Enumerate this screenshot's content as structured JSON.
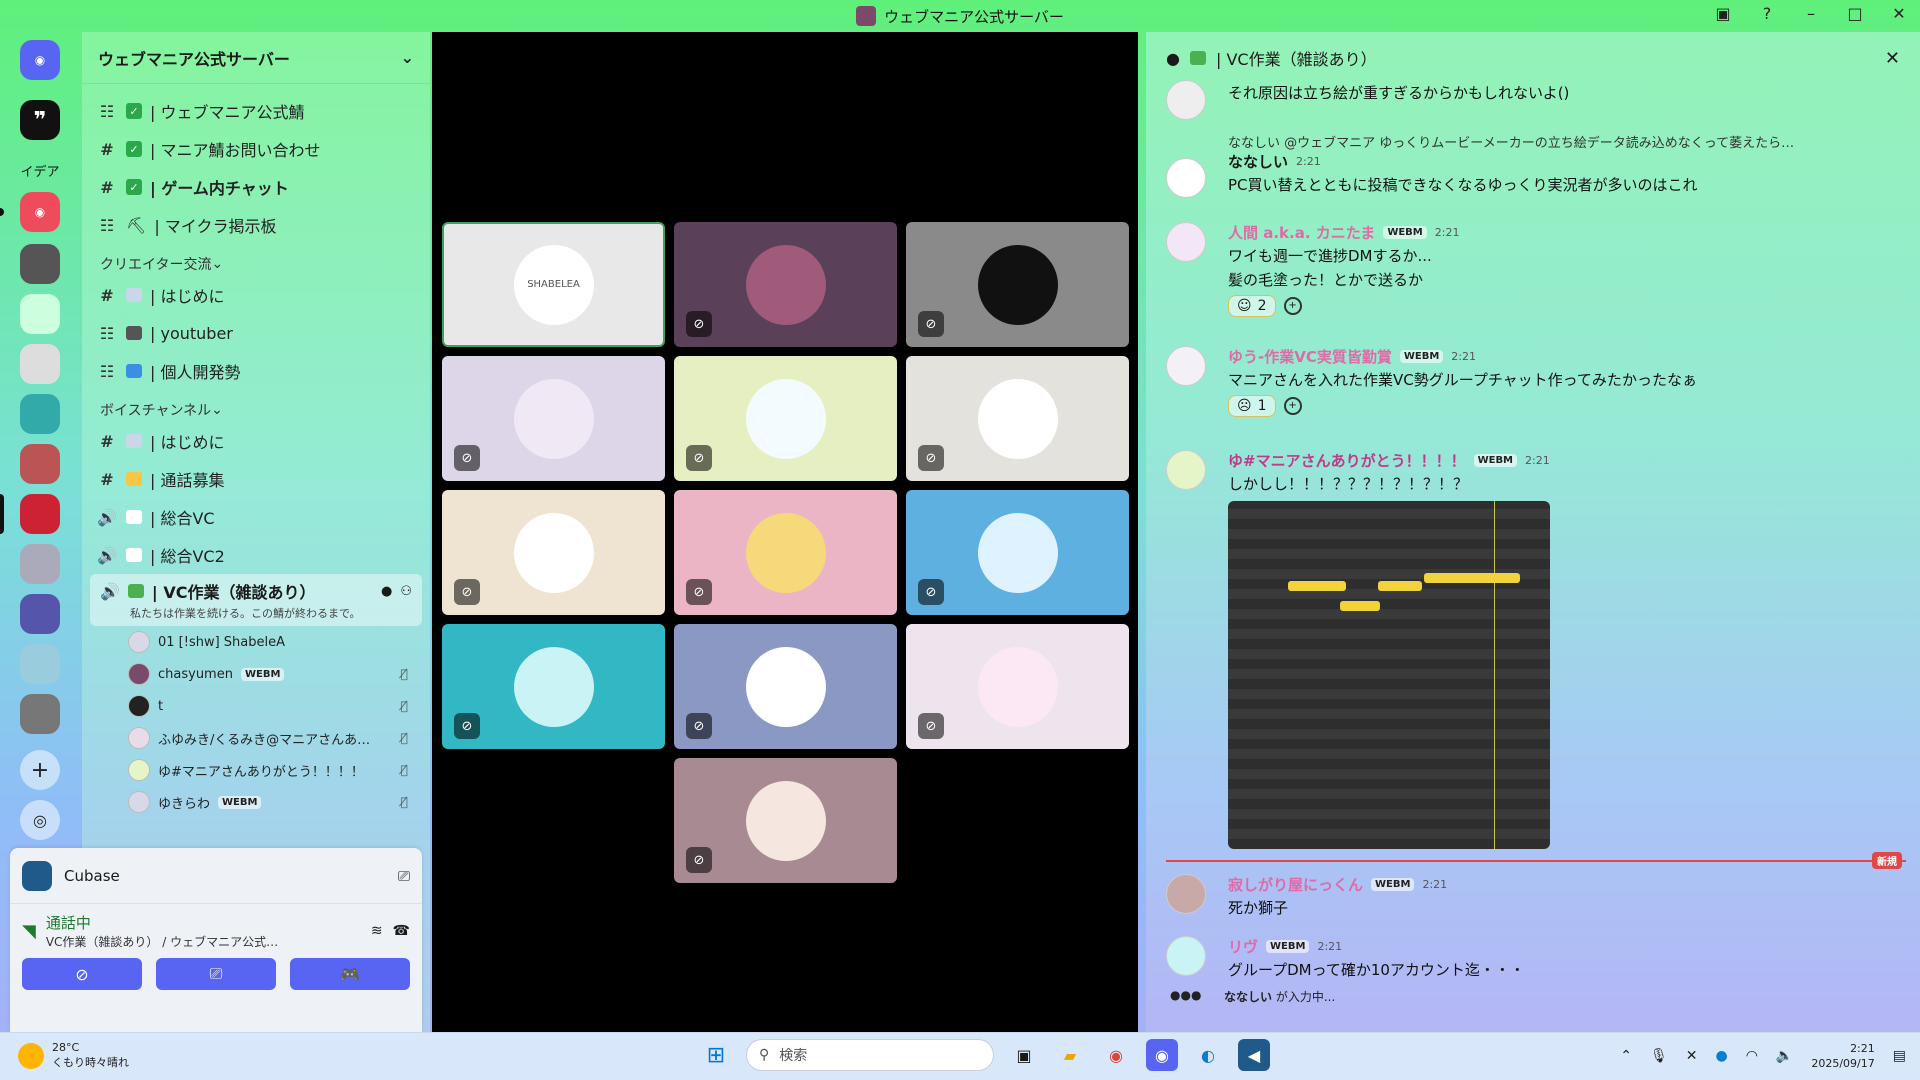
{
  "window": {
    "title": "ウェブマニア公式サーバー"
  },
  "server": {
    "name": "ウェブマニア公式サーバー"
  },
  "channels_top": [
    {
      "icon": "forum",
      "label": "| ウェブマニア公式鯖"
    },
    {
      "icon": "#",
      "label": "| マニア鯖お問い合わせ"
    },
    {
      "icon": "#",
      "label": "| ゲーム内チャット"
    },
    {
      "icon": "forum",
      "label": "| マイクラ掲示板"
    }
  ],
  "categories": {
    "creator": "クリエイター交流",
    "voice": "ボイスチャンネル"
  },
  "creator_channels": [
    {
      "icon": "#",
      "label": "| はじめに"
    },
    {
      "icon": "forum",
      "label": "| youtuber"
    },
    {
      "icon": "forum",
      "label": "| 個人開発勢"
    }
  ],
  "voice_channels": [
    {
      "icon": "#",
      "label": "| はじめに"
    },
    {
      "icon": "#",
      "label": "| 通話募集"
    },
    {
      "icon": "vc",
      "label": "| 総合VC"
    },
    {
      "icon": "vc",
      "label": "| 総合VC2"
    }
  ],
  "active_vc": {
    "name": "| VC作業（雑談あり）",
    "topic": "私たちは作業を続ける。この鯖が終わるまで。"
  },
  "voice_users": [
    {
      "name": "01 [!shw] ShabeleA",
      "tag": ""
    },
    {
      "name": "chasyumen",
      "tag": "WEBM"
    },
    {
      "name": "t",
      "tag": ""
    },
    {
      "name": "ふゆみき/くるみき@マニアさんあ…",
      "tag": ""
    },
    {
      "name": "ゆ#マニアさんありがとう！！！！",
      "tag": ""
    },
    {
      "name": "ゆきらわ",
      "tag": "WEBM"
    }
  ],
  "panel": {
    "app_name": "Cubase",
    "status": "通話中",
    "channel_path": "VC作業（雑談あり） / ウェブマニア公式…"
  },
  "stage": {
    "tile_0_label": "SHABELEA"
  },
  "thread": {
    "title": "| VC作業（雑談あり）",
    "new_label": "新規",
    "typing_user": "ななしい",
    "typing_suffix": "が入力中..."
  },
  "messages": [
    {
      "name": "",
      "time": "",
      "text": "それ原因は立ち絵が重すぎるからかもしれないよ()"
    },
    {
      "reply": "ななしい @ウェブマニア ゆっくりムービーメーカーの立ち絵データ読み込めなくって萎えたら…",
      "name": "ななしい",
      "time": "2:21",
      "text": "PC買い替えとともに投稿できなくなるゆっくり実況者が多いのはこれ"
    },
    {
      "name": "人間 a.k.a. カニたま",
      "tag": "WEBM",
      "time": "2:21",
      "text": "ワイも週一で進捗DMするか...",
      "text2": "髪の毛塗った！とかで送るか",
      "reaction": "2"
    },
    {
      "name": "ゆう-作業VC実質皆勤賞",
      "tag": "WEBM",
      "time": "2:21",
      "text": "マニアさんを入れた作業VC勢グループチャット作ってみたかったなぁ",
      "reaction": "1"
    },
    {
      "name": "ゆ#マニアさんありがとう！！！！",
      "tag": "WEBM",
      "time": "2:21",
      "text": "しかしし！！！？？？！？！？！？"
    },
    {
      "name": "寂しがり屋にっくん",
      "tag": "WEBM",
      "time": "2:21",
      "text": "死か獅子"
    },
    {
      "name": "リヴ",
      "tag": "WEBM",
      "time": "2:21",
      "text": "グループDMって確か10アカウント迄・・・"
    }
  ],
  "taskbar": {
    "temp": "28°C",
    "weather": "くもり時々晴れ",
    "search_placeholder": "検索",
    "time": "2:21",
    "date": "2025/09/17"
  },
  "guild_labels": {
    "idea": "イデア"
  },
  "colors": {
    "accent": "#5865f2",
    "online": "#2aa84a",
    "new": "#e04747"
  }
}
